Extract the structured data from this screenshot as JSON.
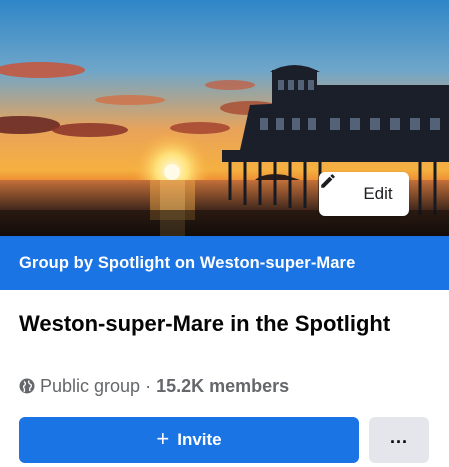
{
  "cover": {
    "image_description_icon": "sunset-pier-photo",
    "edit_label": "Edit",
    "edit_icon": "pencil-icon"
  },
  "banner": {
    "text": "Group by Spotlight on Weston-super-Mare",
    "color": "#1b74e4"
  },
  "group": {
    "name": "Weston-super-Mare in the Spotlight",
    "privacy_icon": "globe-icon",
    "privacy": "Public group",
    "separator": "·",
    "members": "15.2K members"
  },
  "actions": {
    "invite_icon": "plus-icon",
    "invite_plus": "+",
    "invite_label": "Invite",
    "more_label": "...",
    "more_icon": "ellipsis-icon"
  },
  "colors": {
    "primary": "#1b74e4",
    "secondary_button": "#e4e6eb",
    "meta_text": "#65676b"
  }
}
